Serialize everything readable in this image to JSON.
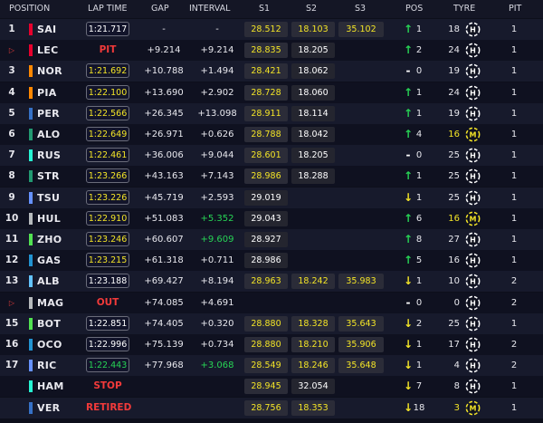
{
  "header": {
    "position": "POSITION",
    "lap_time": "LAP TIME",
    "gap": "GAP",
    "interval": "INTERVAL",
    "s1": "S1",
    "s2": "S2",
    "s3": "S3",
    "pos": "POS",
    "tyre": "TYRE",
    "pit": "PIT"
  },
  "colors": {
    "bg": "#0d0f1b",
    "row_odd": "#171a2c",
    "row_even": "#0f1120",
    "yellow": "#f3e427",
    "green": "#27d455",
    "red": "#f23a3a",
    "team": {
      "ferrari": "#e8002d",
      "mclaren": "#ff8700",
      "redbull": "#3671c6",
      "aston": "#229971",
      "mercedes": "#27f4d2",
      "rb": "#6692ff",
      "haas": "#b6babd",
      "sauber": "#52e252",
      "alpine": "#2293d1",
      "williams": "#64c4ff"
    }
  },
  "rows": [
    {
      "pos": "1",
      "driver": "SAI",
      "team": "ferrari",
      "lap": "1:21.717",
      "lap_color": "white",
      "gap": "-",
      "interval": "-",
      "s1": "28.512",
      "s1c": "yellow",
      "s2": "18.103",
      "s2c": "yellow",
      "s3": "35.102",
      "s3c": "yellow",
      "arrow": "↑",
      "arrowc": "green",
      "change": "1",
      "tyre_laps": "18",
      "tyre": "H",
      "tyre_color": "white",
      "pit": "1"
    },
    {
      "pos": "",
      "out_marker": true,
      "driver": "LEC",
      "team": "ferrari",
      "status": "PIT",
      "gap": "+9.214",
      "interval": "+9.214",
      "s1": "28.835",
      "s1c": "yellow",
      "s2": "18.205",
      "s2c": "plain",
      "s3": "",
      "arrow": "↑",
      "arrowc": "green",
      "change": "2",
      "tyre_laps": "24",
      "tyre": "H",
      "tyre_color": "white",
      "pit": "1"
    },
    {
      "pos": "3",
      "driver": "NOR",
      "team": "mclaren",
      "lap": "1:21.692",
      "lap_color": "yellow",
      "gap": "+10.788",
      "interval": "+1.494",
      "s1": "28.421",
      "s1c": "yellow",
      "s2": "18.062",
      "s2c": "plain",
      "s3": "",
      "arrow": "-",
      "arrowc": "plain",
      "change": "0",
      "tyre_laps": "19",
      "tyre": "H",
      "tyre_color": "white",
      "pit": "1"
    },
    {
      "pos": "4",
      "driver": "PIA",
      "team": "mclaren",
      "lap": "1:22.100",
      "lap_color": "yellow",
      "gap": "+13.690",
      "interval": "+2.902",
      "s1": "28.728",
      "s1c": "yellow",
      "s2": "18.060",
      "s2c": "plain",
      "s3": "",
      "arrow": "↑",
      "arrowc": "green",
      "change": "1",
      "tyre_laps": "24",
      "tyre": "H",
      "tyre_color": "white",
      "pit": "1"
    },
    {
      "pos": "5",
      "driver": "PER",
      "team": "redbull",
      "lap": "1:22.566",
      "lap_color": "yellow",
      "gap": "+26.345",
      "interval": "+13.098",
      "s1": "28.911",
      "s1c": "yellow",
      "s2": "18.114",
      "s2c": "plain",
      "s3": "",
      "arrow": "↑",
      "arrowc": "green",
      "change": "1",
      "tyre_laps": "19",
      "tyre": "H",
      "tyre_color": "white",
      "pit": "1"
    },
    {
      "pos": "6",
      "driver": "ALO",
      "team": "aston",
      "lap": "1:22.649",
      "lap_color": "yellow",
      "gap": "+26.971",
      "interval": "+0.626",
      "s1": "28.788",
      "s1c": "yellow",
      "s2": "18.042",
      "s2c": "plain",
      "s3": "",
      "arrow": "↑",
      "arrowc": "green",
      "change": "4",
      "tyre_laps": "16",
      "tyre_laps_color": "yellow",
      "tyre": "M",
      "tyre_color": "yellow",
      "pit": "1"
    },
    {
      "pos": "7",
      "driver": "RUS",
      "team": "mercedes",
      "lap": "1:22.461",
      "lap_color": "yellow",
      "gap": "+36.006",
      "interval": "+9.044",
      "s1": "28.601",
      "s1c": "yellow",
      "s2": "18.205",
      "s2c": "plain",
      "s3": "",
      "arrow": "-",
      "arrowc": "plain",
      "change": "0",
      "tyre_laps": "25",
      "tyre": "H",
      "tyre_color": "white",
      "pit": "1"
    },
    {
      "pos": "8",
      "driver": "STR",
      "team": "aston",
      "lap": "1:23.266",
      "lap_color": "yellow",
      "gap": "+43.163",
      "interval": "+7.143",
      "s1": "28.986",
      "s1c": "yellow",
      "s2": "18.288",
      "s2c": "plain",
      "s3": "",
      "arrow": "↑",
      "arrowc": "green",
      "change": "1",
      "tyre_laps": "25",
      "tyre": "H",
      "tyre_color": "white",
      "pit": "1"
    },
    {
      "pos": "9",
      "driver": "TSU",
      "team": "rb",
      "lap": "1:23.226",
      "lap_color": "yellow",
      "gap": "+45.719",
      "interval": "+2.593",
      "s1": "29.019",
      "s1c": "plain",
      "s2": "",
      "s3": "",
      "arrow": "↓",
      "arrowc": "yellow",
      "change": "1",
      "tyre_laps": "25",
      "tyre": "H",
      "tyre_color": "white",
      "pit": "1"
    },
    {
      "pos": "10",
      "driver": "HUL",
      "team": "haas",
      "lap": "1:22.910",
      "lap_color": "yellow",
      "gap": "+51.083",
      "interval": "+5.352",
      "interval_color": "green",
      "s1": "29.043",
      "s1c": "plain",
      "s2": "",
      "s3": "",
      "arrow": "↑",
      "arrowc": "green",
      "change": "6",
      "tyre_laps": "16",
      "tyre_laps_color": "yellow",
      "tyre": "M",
      "tyre_color": "yellow",
      "pit": "1"
    },
    {
      "pos": "11",
      "driver": "ZHO",
      "team": "sauber",
      "lap": "1:23.246",
      "lap_color": "yellow",
      "gap": "+60.607",
      "interval": "+9.609",
      "interval_color": "green",
      "s1": "28.927",
      "s1c": "plain",
      "s2": "",
      "s3": "",
      "arrow": "↑",
      "arrowc": "green",
      "change": "8",
      "tyre_laps": "27",
      "tyre": "H",
      "tyre_color": "white",
      "pit": "1"
    },
    {
      "pos": "12",
      "driver": "GAS",
      "team": "alpine",
      "lap": "1:23.215",
      "lap_color": "yellow",
      "gap": "+61.318",
      "interval": "+0.711",
      "s1": "28.986",
      "s1c": "plain",
      "s2": "",
      "s3": "",
      "arrow": "↑",
      "arrowc": "green",
      "change": "5",
      "tyre_laps": "16",
      "tyre": "H",
      "tyre_color": "white",
      "pit": "1"
    },
    {
      "pos": "13",
      "driver": "ALB",
      "team": "williams",
      "lap": "1:23.188",
      "lap_color": "white",
      "gap": "+69.427",
      "interval": "+8.194",
      "s1": "28.963",
      "s1c": "yellow",
      "s2": "18.242",
      "s2c": "yellow",
      "s3": "35.983",
      "s3c": "yellow",
      "arrow": "↓",
      "arrowc": "yellow",
      "change": "1",
      "tyre_laps": "10",
      "tyre": "H",
      "tyre_color": "white",
      "pit": "2"
    },
    {
      "pos": "",
      "out_marker": true,
      "driver": "MAG",
      "team": "haas",
      "status": "OUT",
      "gap": "+74.085",
      "interval": "+4.691",
      "s1": "",
      "s2": "",
      "s3": "",
      "arrow": "-",
      "arrowc": "plain",
      "change": "0",
      "tyre_laps": "0",
      "tyre": "H",
      "tyre_color": "white",
      "pit": "2"
    },
    {
      "pos": "15",
      "driver": "BOT",
      "team": "sauber",
      "lap": "1:22.851",
      "lap_color": "white",
      "gap": "+74.405",
      "interval": "+0.320",
      "s1": "28.880",
      "s1c": "yellow",
      "s2": "18.328",
      "s2c": "yellow",
      "s3": "35.643",
      "s3c": "yellow",
      "arrow": "↓",
      "arrowc": "yellow",
      "change": "2",
      "tyre_laps": "25",
      "tyre": "H",
      "tyre_color": "white",
      "pit": "1"
    },
    {
      "pos": "16",
      "driver": "OCO",
      "team": "alpine",
      "lap": "1:22.996",
      "lap_color": "white",
      "gap": "+75.139",
      "interval": "+0.734",
      "s1": "28.880",
      "s1c": "yellow",
      "s2": "18.210",
      "s2c": "yellow",
      "s3": "35.906",
      "s3c": "yellow",
      "arrow": "↓",
      "arrowc": "yellow",
      "change": "1",
      "tyre_laps": "17",
      "tyre": "H",
      "tyre_color": "white",
      "pit": "2"
    },
    {
      "pos": "17",
      "driver": "RIC",
      "team": "rb",
      "lap": "1:22.443",
      "lap_color": "green",
      "gap": "+77.968",
      "interval": "+3.068",
      "interval_color": "green",
      "s1": "28.549",
      "s1c": "yellow",
      "s2": "18.246",
      "s2c": "yellow",
      "s3": "35.648",
      "s3c": "yellow",
      "arrow": "↓",
      "arrowc": "yellow",
      "change": "1",
      "tyre_laps": "4",
      "tyre": "H",
      "tyre_color": "white",
      "pit": "2"
    },
    {
      "pos": "",
      "driver": "HAM",
      "team": "mercedes",
      "status": "STOP",
      "gap": "",
      "interval": "",
      "s1": "28.945",
      "s1c": "yellow",
      "s2": "32.054",
      "s2c": "plain",
      "s3": "",
      "arrow": "↓",
      "arrowc": "yellow",
      "change": "7",
      "tyre_laps": "8",
      "tyre": "H",
      "tyre_color": "white",
      "pit": "1"
    },
    {
      "pos": "",
      "driver": "VER",
      "team": "redbull",
      "status": "RETIRED",
      "gap": "",
      "interval": "",
      "s1": "28.756",
      "s1c": "yellow",
      "s2": "18.353",
      "s2c": "yellow",
      "s3": "",
      "arrow": "↓",
      "arrowc": "yellow",
      "change": "18",
      "tyre_laps": "3",
      "tyre_laps_color": "yellow",
      "tyre": "M",
      "tyre_color": "yellow",
      "pit": "1"
    }
  ]
}
